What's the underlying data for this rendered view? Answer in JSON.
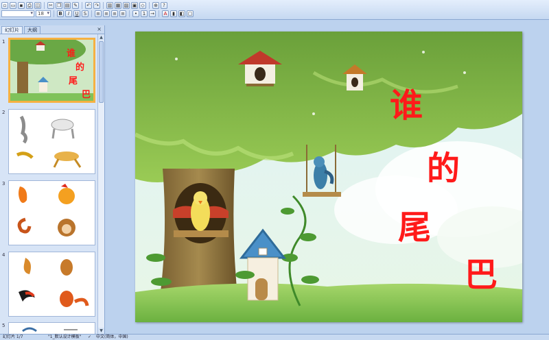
{
  "toolbar": {
    "font_name": "",
    "font_size": "18",
    "bold": "B",
    "italic": "I",
    "underline": "U",
    "strike": "S",
    "font_color": "A"
  },
  "panel": {
    "tab_slides": "幻灯片",
    "tab_outline": "大纲",
    "close": "×",
    "slide_numbers": [
      "1",
      "2",
      "3",
      "4",
      "5"
    ]
  },
  "slide": {
    "title_chars": [
      "谁",
      "的",
      "尾",
      "巴"
    ],
    "title_color": "#ff1a1a"
  },
  "status": {
    "slide_counter": "幻灯片 1/7",
    "theme": "\"1_默认设计模板\"",
    "language": "中文(简体，中国)"
  }
}
